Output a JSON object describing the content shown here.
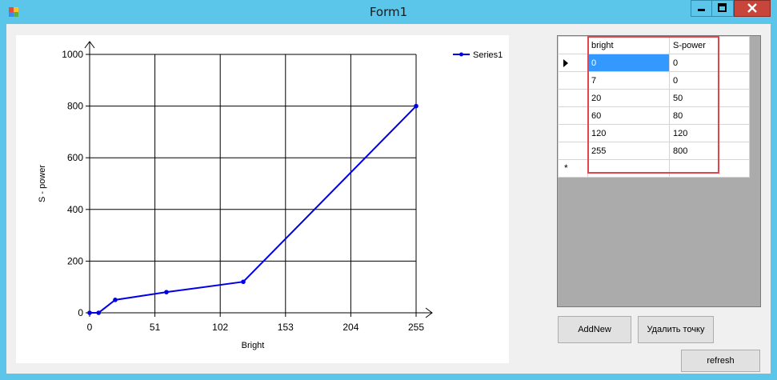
{
  "window": {
    "title": "Form1"
  },
  "colors": {
    "titlebar": "#5bc6ea",
    "close_button": "#c7453a",
    "series": "#0000e6",
    "highlight": "#e0464b",
    "selection": "#3399ff"
  },
  "chart_data": {
    "type": "line",
    "xlabel": "Bright",
    "ylabel": "S - power",
    "xlim": [
      0,
      255
    ],
    "ylim": [
      0,
      1000
    ],
    "xticks": [
      0,
      51,
      102,
      153,
      204,
      255
    ],
    "yticks": [
      0,
      200,
      400,
      600,
      800,
      1000
    ],
    "grid": true,
    "legend": "top-right",
    "series": [
      {
        "name": "Series1",
        "x": [
          0,
          7,
          20,
          60,
          120,
          255
        ],
        "y": [
          0,
          0,
          50,
          80,
          120,
          800
        ]
      }
    ]
  },
  "grid": {
    "columns": [
      "bright",
      "S-power"
    ],
    "rows": [
      [
        "0",
        "0"
      ],
      [
        "7",
        "0"
      ],
      [
        "20",
        "50"
      ],
      [
        "60",
        "80"
      ],
      [
        "120",
        "120"
      ],
      [
        "255",
        "800"
      ]
    ],
    "new_row_marker": "*"
  },
  "buttons": {
    "add": "AddNew",
    "delete": "Удалить точку",
    "refresh": "refresh"
  }
}
